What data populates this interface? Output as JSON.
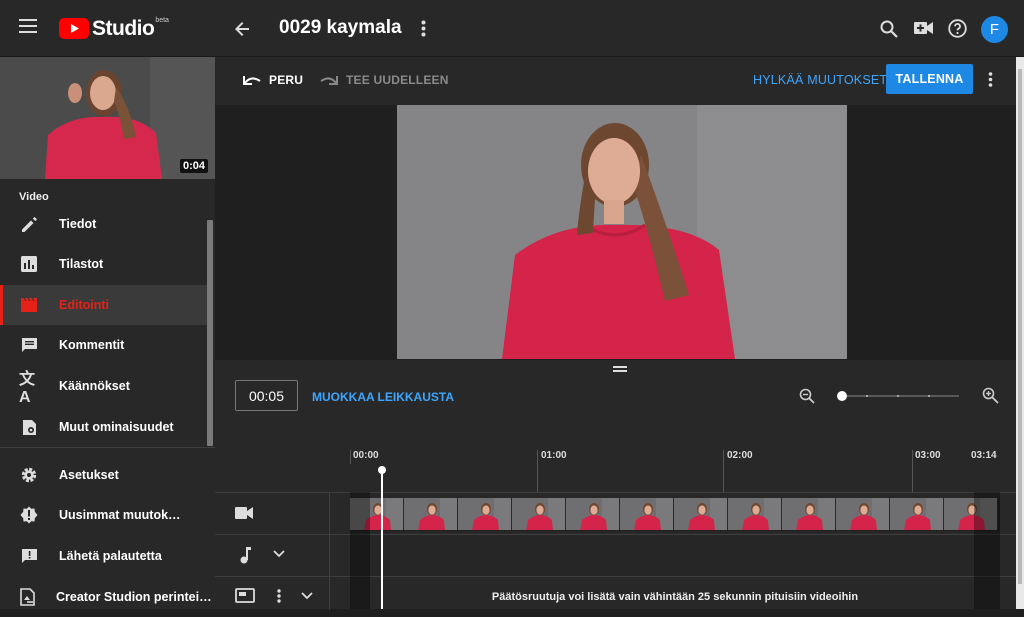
{
  "header": {
    "logo_text": "Studio",
    "logo_badge": "beta",
    "title": "0029 kaymala",
    "avatar_letter": "F",
    "colors": {
      "youtube_red": "#ff0000",
      "accent_blue": "#3ea6ff",
      "save_blue": "#1e88e5",
      "active_red": "#e62117"
    }
  },
  "sidebar": {
    "thumb_duration": "0:04",
    "section_label": "Video",
    "items": [
      {
        "label": "Tiedot",
        "icon": "pencil-icon"
      },
      {
        "label": "Tilastot",
        "icon": "analytics-icon"
      },
      {
        "label": "Editointi",
        "icon": "clapper-icon",
        "active": true
      },
      {
        "label": "Kommentit",
        "icon": "comment-icon"
      },
      {
        "label": "Käännökset",
        "icon": "translate-icon"
      },
      {
        "label": "Muut ominaisuudet",
        "icon": "more-features-icon"
      }
    ],
    "footer_items": [
      {
        "label": "Asetukset",
        "icon": "gear-icon"
      },
      {
        "label": "Uusimmat muutok…",
        "icon": "alert-icon"
      },
      {
        "label": "Lähetä palautetta",
        "icon": "feedback-icon"
      },
      {
        "label": "Creator Studion perintei…",
        "icon": "classic-studio-icon"
      }
    ]
  },
  "editor": {
    "undo_label": "PERU",
    "redo_label": "TEE UUDELLEEN",
    "discard_label": "HYLKÄÄ MUUTOKSET",
    "save_label": "TALLENNA"
  },
  "timeline": {
    "current_time": "00:05",
    "trim_label": "MUOKKAA LEIKKAUSTA",
    "ticks": [
      "00:00",
      "01:00",
      "02:00",
      "03:00",
      "03:14"
    ],
    "zoom_level": 0,
    "endscreen_notice": "Päätösruutuja voi lisätä vain vähintään 25 sekunnin pituisiin videoihin"
  }
}
